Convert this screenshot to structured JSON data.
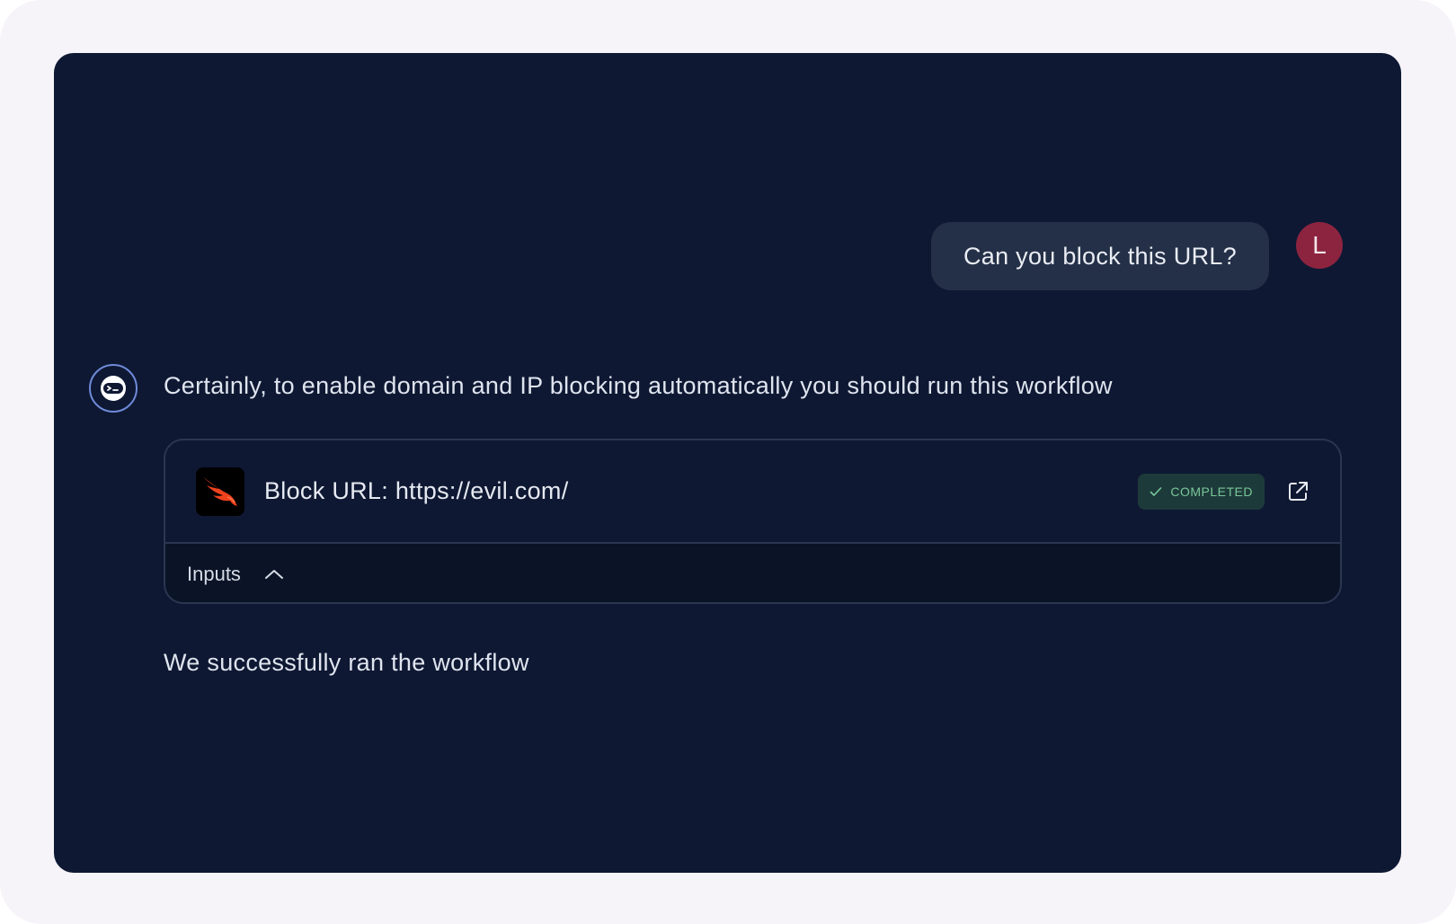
{
  "user_message": {
    "text": "Can you block this URL?",
    "avatar_initial": "L",
    "avatar_color": "#8c2440"
  },
  "assistant": {
    "avatar_icon": "robot-icon",
    "message": "Certainly, to enable domain and IP blocking automatically you should run this workflow",
    "followup": "We successfully ran the workflow"
  },
  "workflow_card": {
    "app_icon": "falcon-icon",
    "title": "Block URL: https://evil.com/",
    "status": "COMPLETED",
    "status_color": "#79c79a",
    "external_link_icon": "external-link-icon",
    "inputs_label": "Inputs",
    "inputs_toggle_icon": "chevron-up-icon"
  },
  "colors": {
    "panel_bg": "#0e1833",
    "bubble_bg": "#243047",
    "accent": "#6f8ad8"
  }
}
